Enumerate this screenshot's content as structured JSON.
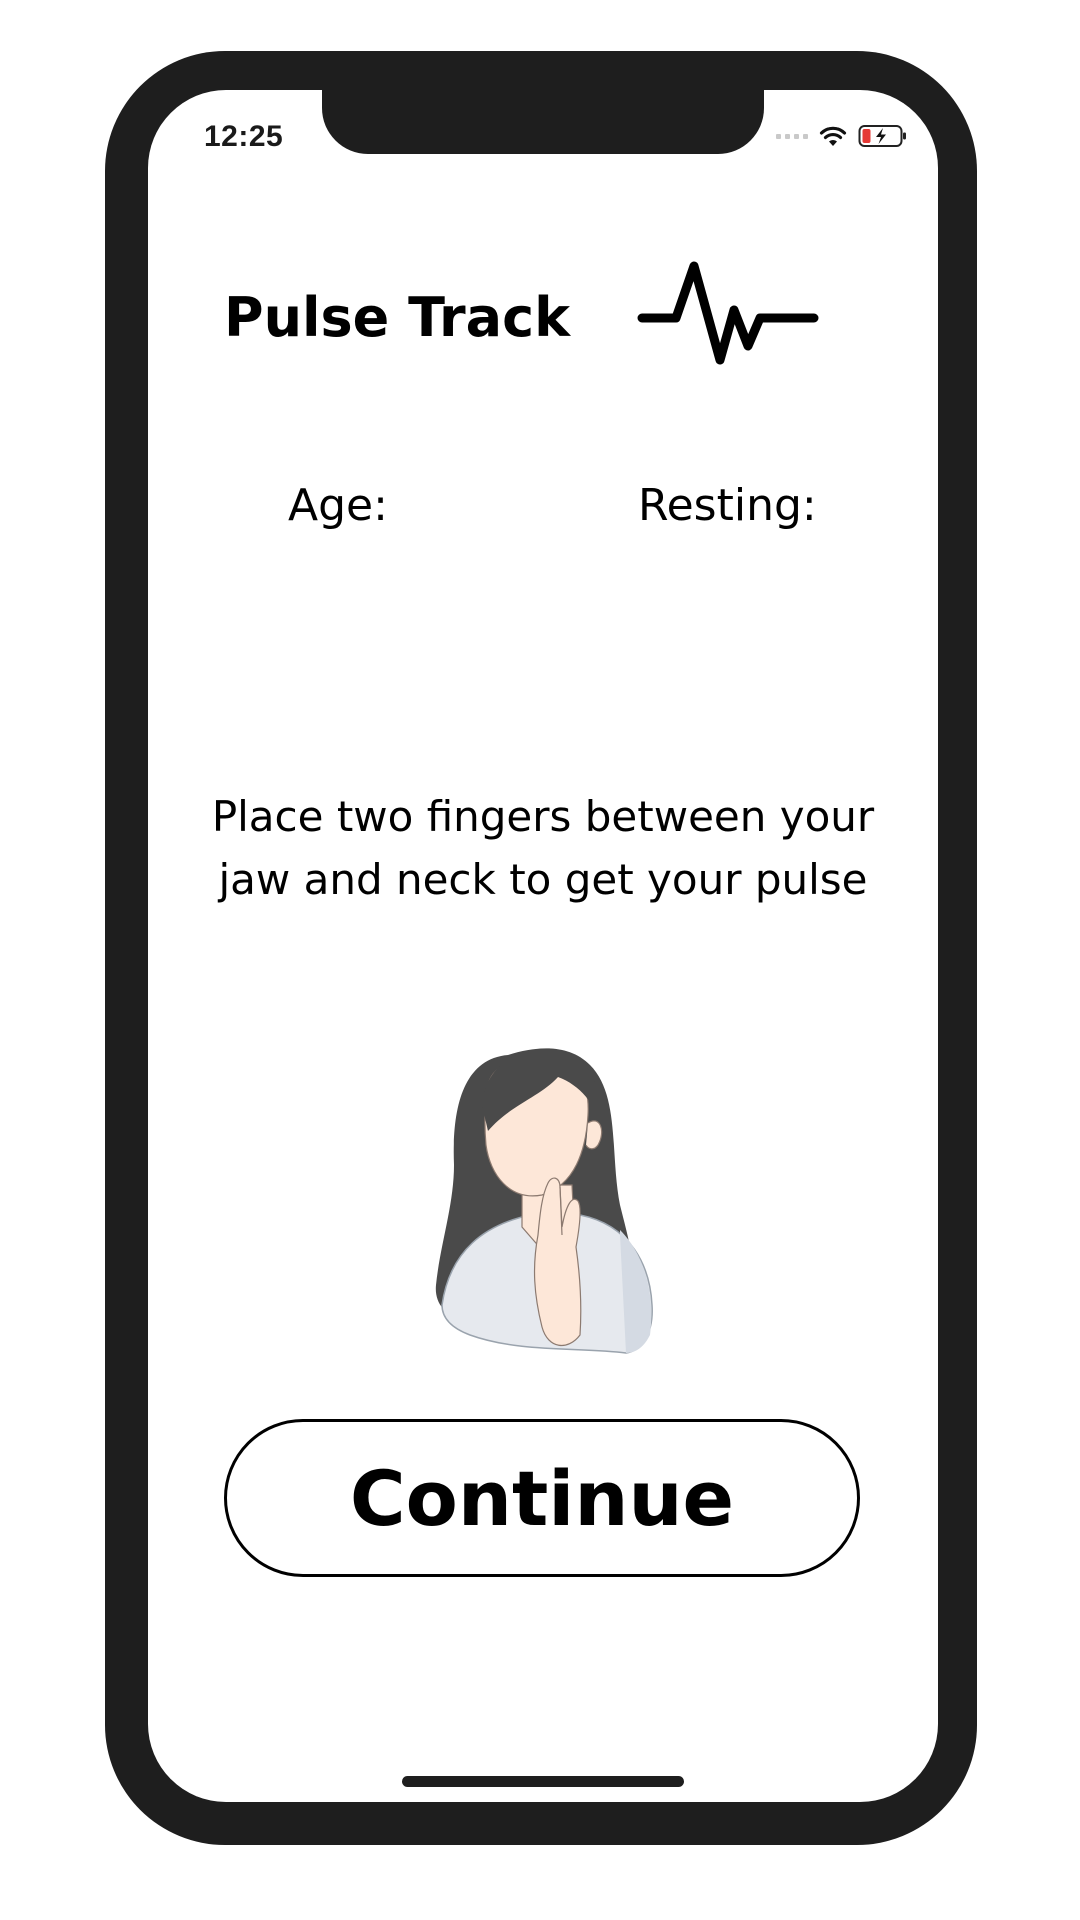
{
  "status_bar": {
    "time": "12:25",
    "signal_icon": "cellular-signal-icon",
    "wifi_icon": "wifi-icon",
    "battery_icon": "battery-charging-icon",
    "battery_color": "#e53935"
  },
  "header": {
    "title": "Pulse Track",
    "icon": "pulse-waveform-icon"
  },
  "stats": {
    "age_label": "Age:",
    "resting_label": "Resting:"
  },
  "instruction": {
    "text": "Place two fingers between your jaw and neck to get your pulse"
  },
  "illustration": {
    "icon": "woman-checking-pulse-illustration"
  },
  "actions": {
    "continue_label": "Continue"
  },
  "colors": {
    "frame": "#1e1e1e",
    "background": "#ffffff",
    "text": "#000000"
  }
}
